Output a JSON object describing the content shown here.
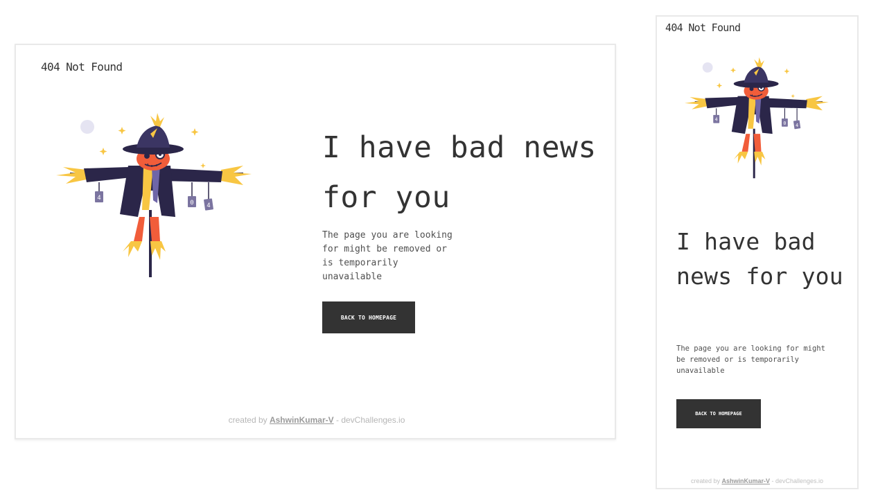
{
  "desktop": {
    "brand": "404 Not Found",
    "headline": "I have bad news for you",
    "message": "The page you are looking for might be removed or is temporarily unavailable",
    "cta_label": "BACK TO HOMEPAGE",
    "footer": {
      "prefix": "created by ",
      "author": "AshwinKumar-V",
      "suffix": " - devChallenges.io"
    }
  },
  "mobile": {
    "brand": "404 Not Found",
    "headline": "I have bad news for you",
    "message": "The page you are looking for might be removed or is temporarily unavailable",
    "cta_label": "BACK TO HOMEPAGE",
    "footer": {
      "prefix": "created by ",
      "author": "AshwinKumar-V",
      "suffix": " - devChallenges.io"
    }
  },
  "illustration": {
    "name": "scarecrow-illustration",
    "tags": [
      "4",
      "0",
      "4"
    ]
  },
  "colors": {
    "text_dark": "#333333",
    "text_body": "#4f4f4f",
    "button_bg": "#333333",
    "button_text": "#ffffff",
    "scarecrow_coat": "#2b2649",
    "scarecrow_face": "#f15d3a",
    "straw": "#f8c643",
    "tag": "#7b74a0"
  }
}
